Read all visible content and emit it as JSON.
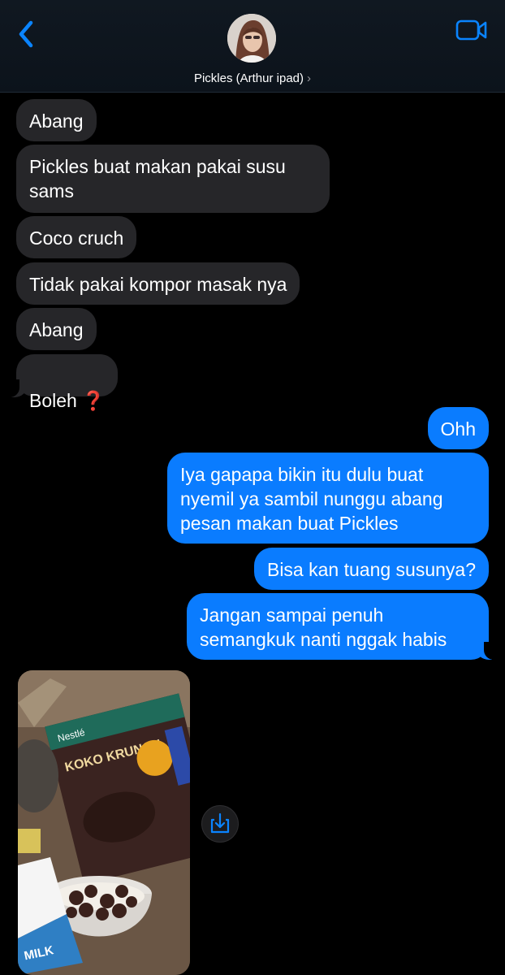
{
  "header": {
    "contact_name": "Pickles (Arthur ipad)",
    "chevron": "›",
    "icons": {
      "back": "chevron-left-icon",
      "video": "video-camera-icon"
    },
    "accent_color": "#0a84ff"
  },
  "messages": [
    {
      "direction": "incoming",
      "text": "Abang"
    },
    {
      "direction": "incoming",
      "text": "Pickles buat makan pakai susu\nsams"
    },
    {
      "direction": "incoming",
      "text": "Coco cruch"
    },
    {
      "direction": "incoming",
      "text": "Tidak pakai kompor masak nya"
    },
    {
      "direction": "incoming",
      "text": "Abang"
    },
    {
      "direction": "incoming",
      "text": "Boleh",
      "emoji": "❓"
    },
    {
      "direction": "outgoing",
      "text": "Ohh"
    },
    {
      "direction": "outgoing",
      "text": "Iya gapapa bikin itu dulu buat\nnyemil ya sambil nunggu abang\npesan makan buat Pickles"
    },
    {
      "direction": "outgoing",
      "text": "Bisa kan tuang susunya?"
    },
    {
      "direction": "outgoing",
      "text": "Jangan sampai penuh\nsemangkuk nanti nggak habis"
    }
  ],
  "photo": {
    "box_brand": "Nestlé",
    "box_name": "KOKO KRUNCH",
    "carton_text": "MILK",
    "save_icon": "download-icon"
  },
  "colors": {
    "incoming_bubble": "#262629",
    "outgoing_bubble": "#0a7cff"
  }
}
